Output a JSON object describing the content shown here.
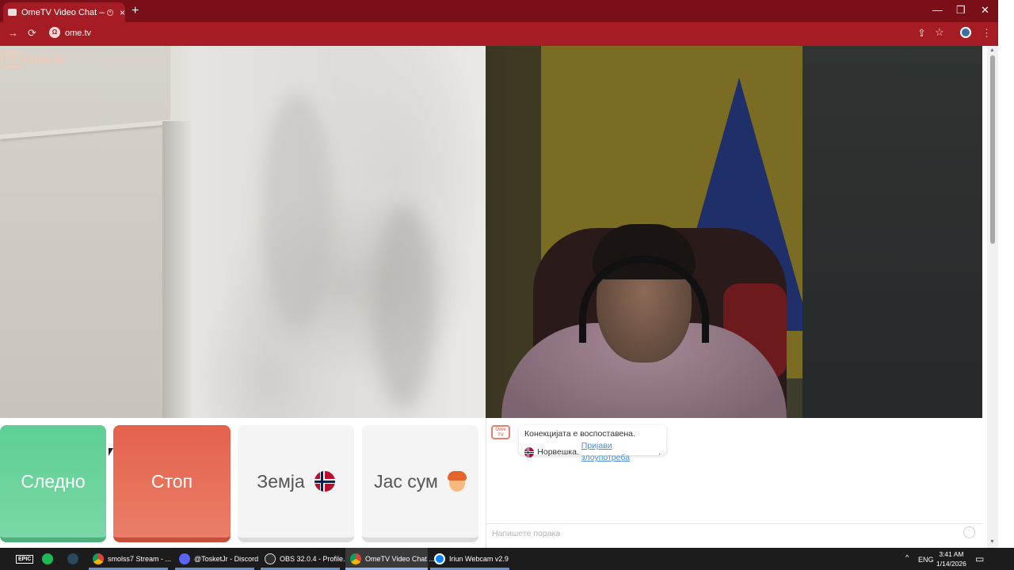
{
  "browser": {
    "tab_title": "OmeTV Video Chat — Ome",
    "tab_close": "×",
    "new_tab": "+",
    "url": "ome.tv",
    "site_badge": "Ω",
    "controls": {
      "minimize": "—",
      "restore": "❐",
      "close": "✕"
    },
    "nav": {
      "forward": "→",
      "reload": "⟳"
    },
    "actions": {
      "install": "⇪",
      "star": "☆",
      "menu": "⋮"
    }
  },
  "logo": {
    "tv": "Ome TV",
    "text": "Ome.tv"
  },
  "buttons": {
    "next": "Следно",
    "stop": "Стоп",
    "country": "Земја",
    "iam": "Јас сум"
  },
  "chat": {
    "logo": "Ome TV",
    "connected": "Конекцијата е воспоставена.",
    "country": "Норвешка.",
    "report": "Пријави злоупотреба",
    "report_suffix": ".",
    "input_placeholder": "Напишете порака"
  },
  "taskbar": {
    "apps": [
      {
        "label": "EPIC",
        "color": "#2a2a2a"
      },
      {
        "label": "",
        "color": "#1db954"
      },
      {
        "label": "",
        "color": "#1b2838"
      },
      {
        "label": "smolss7 Stream - ...",
        "color": "#e04a3a"
      },
      {
        "label": "@TosketJr - Discord",
        "color": "#5865f2"
      },
      {
        "label": "OBS 32.0.4 - Profile...",
        "color": "#302e31"
      },
      {
        "label": "OmeTV Video Chat ...",
        "color": "#e04a3a"
      },
      {
        "label": "Iriun Webcam v2.9",
        "color": "#0a84ff"
      }
    ],
    "tray_arrow": "^",
    "lang": "ENG",
    "time": "3:41 AM",
    "date": "1/14/2026",
    "notif": "▭"
  }
}
